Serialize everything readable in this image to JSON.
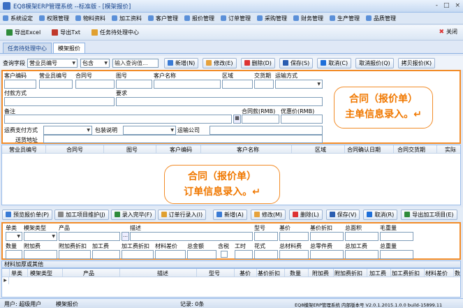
{
  "window": {
    "title": "EQ8模架ERP管理系统 --标准版 - [模架报价]",
    "min": "-",
    "max": "□",
    "close": "×"
  },
  "menu": [
    {
      "label": "系统设定",
      "icon": "settings-icon"
    },
    {
      "label": "权限管理",
      "icon": "permission-icon"
    },
    {
      "label": "物料资料",
      "icon": "material-icon"
    },
    {
      "label": "加工资料",
      "icon": "process-icon"
    },
    {
      "label": "客户管理",
      "icon": "customer-icon"
    },
    {
      "label": "报价管理",
      "icon": "quote-icon"
    },
    {
      "label": "订单管理",
      "icon": "order-icon"
    },
    {
      "label": "采购管理",
      "icon": "purchase-icon"
    },
    {
      "label": "财务管理",
      "icon": "finance-icon"
    },
    {
      "label": "生产管理",
      "icon": "production-icon"
    },
    {
      "label": "品质管理",
      "icon": "quality-icon"
    }
  ],
  "toolbar": {
    "export_excel": "导出Excel",
    "export_txt": "导出Txt",
    "task_center": "任务待处理中心",
    "close": "关闭"
  },
  "tabs": [
    "任务待处理中心",
    "模架报价"
  ],
  "search": {
    "field_label": "查询字段",
    "field_value": "营业员编号",
    "op_value": "包含",
    "placeholder": "输入查询值...",
    "btn_new": "新增(N)",
    "btn_edit": "修改(E)",
    "btn_delete": "删除(D)",
    "btn_save": "保存(S)",
    "btn_cancel": "取消(C)",
    "btn_cancel_quote": "取消报价(Q)",
    "btn_copy_quote": "拷贝报价(K)"
  },
  "form1": {
    "customer_code": "客户编码",
    "sales_no": "营业员编号",
    "contract_no": "合同号",
    "drawing_no": "图号",
    "customer_name": "客户名称",
    "region": "区域",
    "delivery_date": "交货期",
    "ship_method": "运输方式",
    "payment_method": "付款方式",
    "requirement": "要求",
    "remark": "备注",
    "contract_amount": "合同款(RMB)",
    "discount_price": "优惠价(RMB)",
    "freight_payment": "运费支付方式",
    "packing": "包装说明",
    "transport_company": "运输公司",
    "ship_address": "送货地址"
  },
  "callout1": {
    "line1": "合同（报价单）",
    "line2": "主单信息录入。↵"
  },
  "callout2": {
    "line1": "合同（报价单）",
    "line2": "订单信息录入。↵"
  },
  "grid1_headers": [
    "营业员编号",
    "合同号",
    "图号",
    "客户编码",
    "客户名称",
    "区域",
    "合同确认日期",
    "合同交货期",
    "实际"
  ],
  "toolbar3": {
    "preview": "预览报价单(P)",
    "process_maint": "加工项目维护(J)",
    "entry_done": "录入完毕(F)",
    "order_entry": "订单行录入(I)",
    "add": "新增(A)",
    "edit": "修改(M)",
    "delete": "删除(L)",
    "save": "保存(V)",
    "cancel": "取消(R)",
    "export_process": "导出加工项目(E)"
  },
  "form2": {
    "unit": "单类",
    "mold_type": "模架类型",
    "product": "产品",
    "description": "描述",
    "model": "型号",
    "base_price": "基价",
    "base_discount": "基价折扣",
    "total_area": "总面积",
    "gross_weight": "毛重量",
    "quantity": "数量",
    "surcharge": "附加费",
    "surcharge_discount": "附加费折扣",
    "process_fee": "加工费",
    "process_discount": "加工费折扣",
    "material_diff": "材料差价",
    "total_amount": "总金额",
    "tax": "含税",
    "work_time": "工时",
    "pattern": "花式",
    "total_material": "总材料费",
    "total_parts": "总零件费",
    "total_process": "总加工费",
    "total_weight": "总重量"
  },
  "section_label": "材料加厚或其他",
  "grid2_headers": [
    "单类",
    "模架类型",
    "产品",
    "描述",
    "型号",
    "基价",
    "基价折扣",
    "数量",
    "附加费",
    "附加费折扣",
    "加工费",
    "加工费折扣",
    "材料差价",
    "数"
  ],
  "status": {
    "user": "用户: 超级用户",
    "module": "模架报价",
    "records": "记录: 0条",
    "version": "EQ8模架ERP管理系统 内部版本号 V2.0.1.2015.1.0.0 build-15899.11"
  }
}
